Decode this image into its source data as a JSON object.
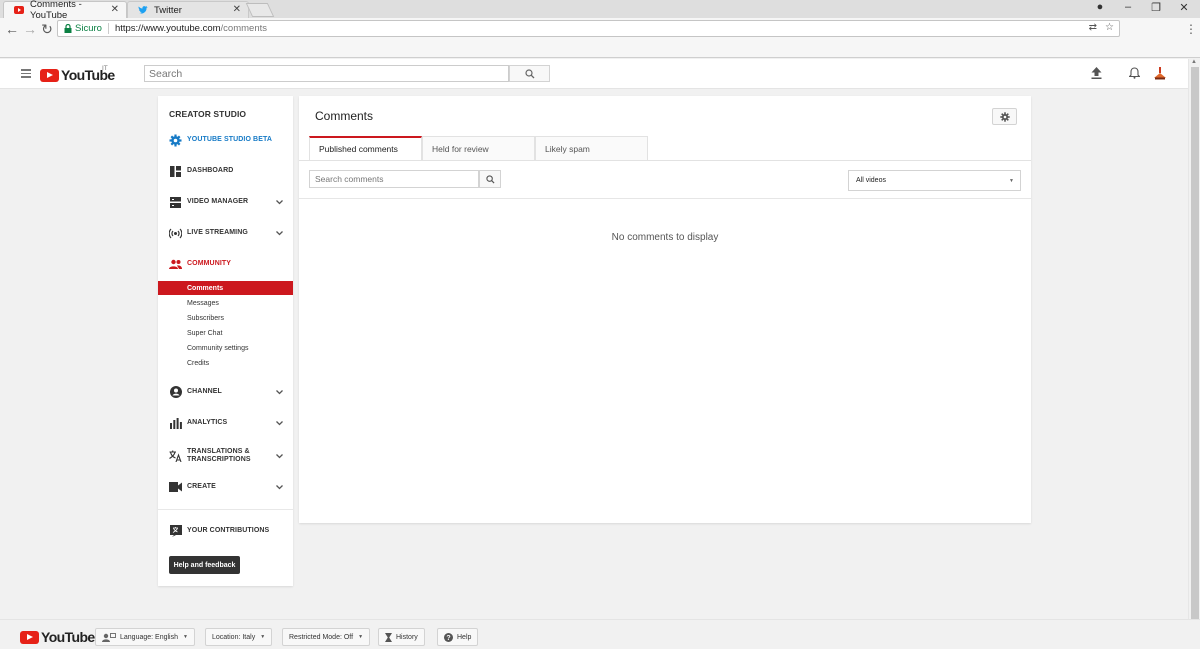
{
  "browser": {
    "tabs": [
      {
        "title": "Comments - YouTube",
        "close": "✕"
      },
      {
        "title": "Twitter",
        "close": "✕"
      }
    ],
    "window_controls": {
      "profile": "●",
      "minimize": "–",
      "restore": "❐",
      "close": "✕"
    },
    "nav": {
      "back": "←",
      "forward": "→",
      "reload": "↻"
    },
    "address": {
      "secure_label": "Sicuro",
      "url_host": "https://www.youtube.com",
      "url_path": "/comments"
    },
    "omni_icons": {
      "translate": "⇄",
      "bookmark": "☆",
      "menu": "⋮"
    }
  },
  "masthead": {
    "logo_text": "YouTube",
    "country": "IT",
    "search_placeholder": "Search"
  },
  "sidebar": {
    "title": "CREATOR STUDIO",
    "items": [
      {
        "label": "YOUTUBE STUDIO BETA",
        "icon": "gear-icon"
      },
      {
        "label": "DASHBOARD",
        "icon": "dashboard-icon"
      },
      {
        "label": "VIDEO MANAGER",
        "icon": "video-manager-icon"
      },
      {
        "label": "LIVE STREAMING",
        "icon": "live-icon"
      },
      {
        "label": "COMMUNITY",
        "icon": "community-icon"
      },
      {
        "label": "CHANNEL",
        "icon": "channel-icon"
      },
      {
        "label": "ANALYTICS",
        "icon": "analytics-icon"
      },
      {
        "label": "TRANSLATIONS &",
        "label2": "TRANSCRIPTIONS",
        "icon": "translate-icon"
      },
      {
        "label": "CREATE",
        "icon": "camera-icon"
      },
      {
        "label": "YOUR CONTRIBUTIONS",
        "icon": "contributions-icon"
      }
    ],
    "community_sub": [
      "Comments",
      "Messages",
      "Subscribers",
      "Super Chat",
      "Community settings",
      "Credits"
    ],
    "help_button": "Help and feedback"
  },
  "main": {
    "title": "Comments",
    "tabs": [
      "Published comments",
      "Held for review",
      "Likely spam"
    ],
    "search_placeholder": "Search comments",
    "filter_selected": "All videos",
    "empty_message": "No comments to display"
  },
  "footer": {
    "logo_text": "YouTube",
    "language": "Language: English",
    "location": "Location: Italy",
    "restricted": "Restricted Mode: Off",
    "history": "History",
    "help": "Help"
  },
  "colors": {
    "accent": "#cc181e",
    "beta_blue": "#167ac6",
    "secure_green": "#0b8043"
  }
}
